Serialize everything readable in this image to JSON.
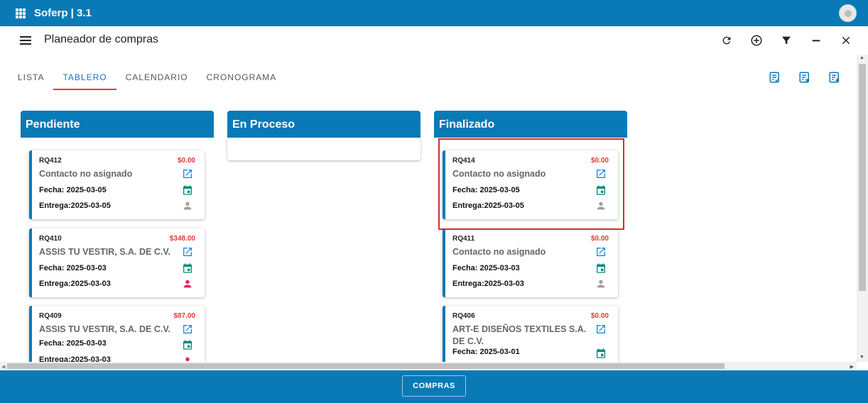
{
  "app": {
    "title": "Soferp | 3.1"
  },
  "header": {
    "title": "Planeador de compras"
  },
  "tabs": [
    {
      "label": "LISTA",
      "active": false
    },
    {
      "label": "TABLERO",
      "active": true
    },
    {
      "label": "CALENDARIO",
      "active": false
    },
    {
      "label": "CRONOGRAMA",
      "active": false
    }
  ],
  "toolbar_icons": [
    "refresh-icon",
    "add-circle-icon",
    "filter-icon",
    "minimize-icon",
    "close-icon"
  ],
  "tab_action_icons": [
    "list-check-icon",
    "list-remove-icon",
    "list-add-icon"
  ],
  "columns": [
    {
      "title": "Pendiente",
      "cards": [
        {
          "code": "RQ412",
          "amount": "$0.00",
          "contact": "Contacto no asignado",
          "fecha": "Fecha: 2025-03-05",
          "entrega": "Entrega:2025-03-05",
          "person_status": "unassigned"
        },
        {
          "code": "RQ410",
          "amount": "$348.00",
          "contact": "ASSIS TU VESTIR, S.A. DE C.V.",
          "fecha": "Fecha: 2025-03-03",
          "entrega": "Entrega:2025-03-03",
          "person_status": "assigned"
        },
        {
          "code": "RQ409",
          "amount": "$87.00",
          "contact": "ASSIS TU VESTIR, S.A. DE C.V.",
          "fecha": "Fecha: 2025-03-03",
          "entrega": "Entrega:2025-03-03",
          "person_status": "assigned"
        }
      ]
    },
    {
      "title": "En Proceso",
      "cards": []
    },
    {
      "title": "Finalizado",
      "cards": [
        {
          "code": "RQ414",
          "amount": "$0.00",
          "contact": "Contacto no asignado",
          "fecha": "Fecha: 2025-03-05",
          "entrega": "Entrega:2025-03-05",
          "person_status": "unassigned"
        },
        {
          "code": "RQ411",
          "amount": "$0.00",
          "contact": "Contacto no asignado",
          "fecha": "Fecha: 2025-03-03",
          "entrega": "Entrega:2025-03-03",
          "person_status": "unassigned"
        },
        {
          "code": "RQ406",
          "amount": "$0.00",
          "contact": "ART-E DISEÑOS TEXTILES S.A. DE C.V.",
          "fecha": "Fecha: 2025-03-01",
          "entrega": "",
          "person_status": "unassigned"
        }
      ]
    }
  ],
  "footer": {
    "button_label": "COMPRAS"
  },
  "colors": {
    "primary": "#0a7ab6",
    "accent_red": "#e53935",
    "calendar_green": "#00897b",
    "assigned_pink": "#e91e63",
    "unassigned_gray": "#9e9e9e",
    "link_blue": "#1e88e5"
  }
}
